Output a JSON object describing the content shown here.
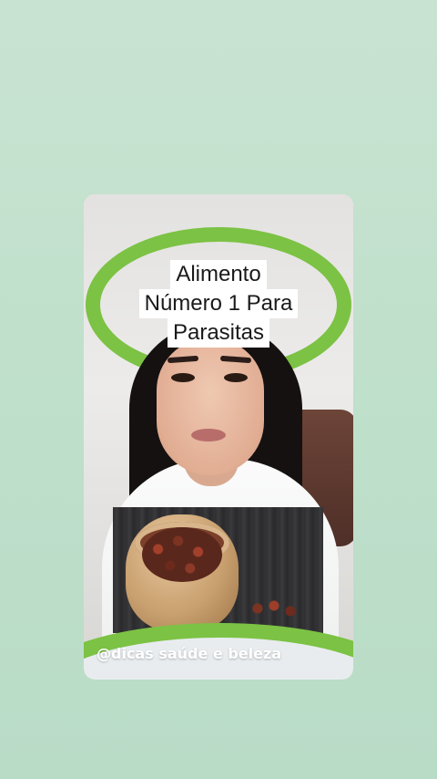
{
  "story": {
    "title_lines": [
      "Alimento",
      "Número 1 Para",
      "Parasitas"
    ],
    "handle": "@dicas saúde e beleza"
  },
  "colors": {
    "background": "#c2dfcc",
    "accent_green": "#7cc244",
    "caption_box": "#ffffff"
  }
}
